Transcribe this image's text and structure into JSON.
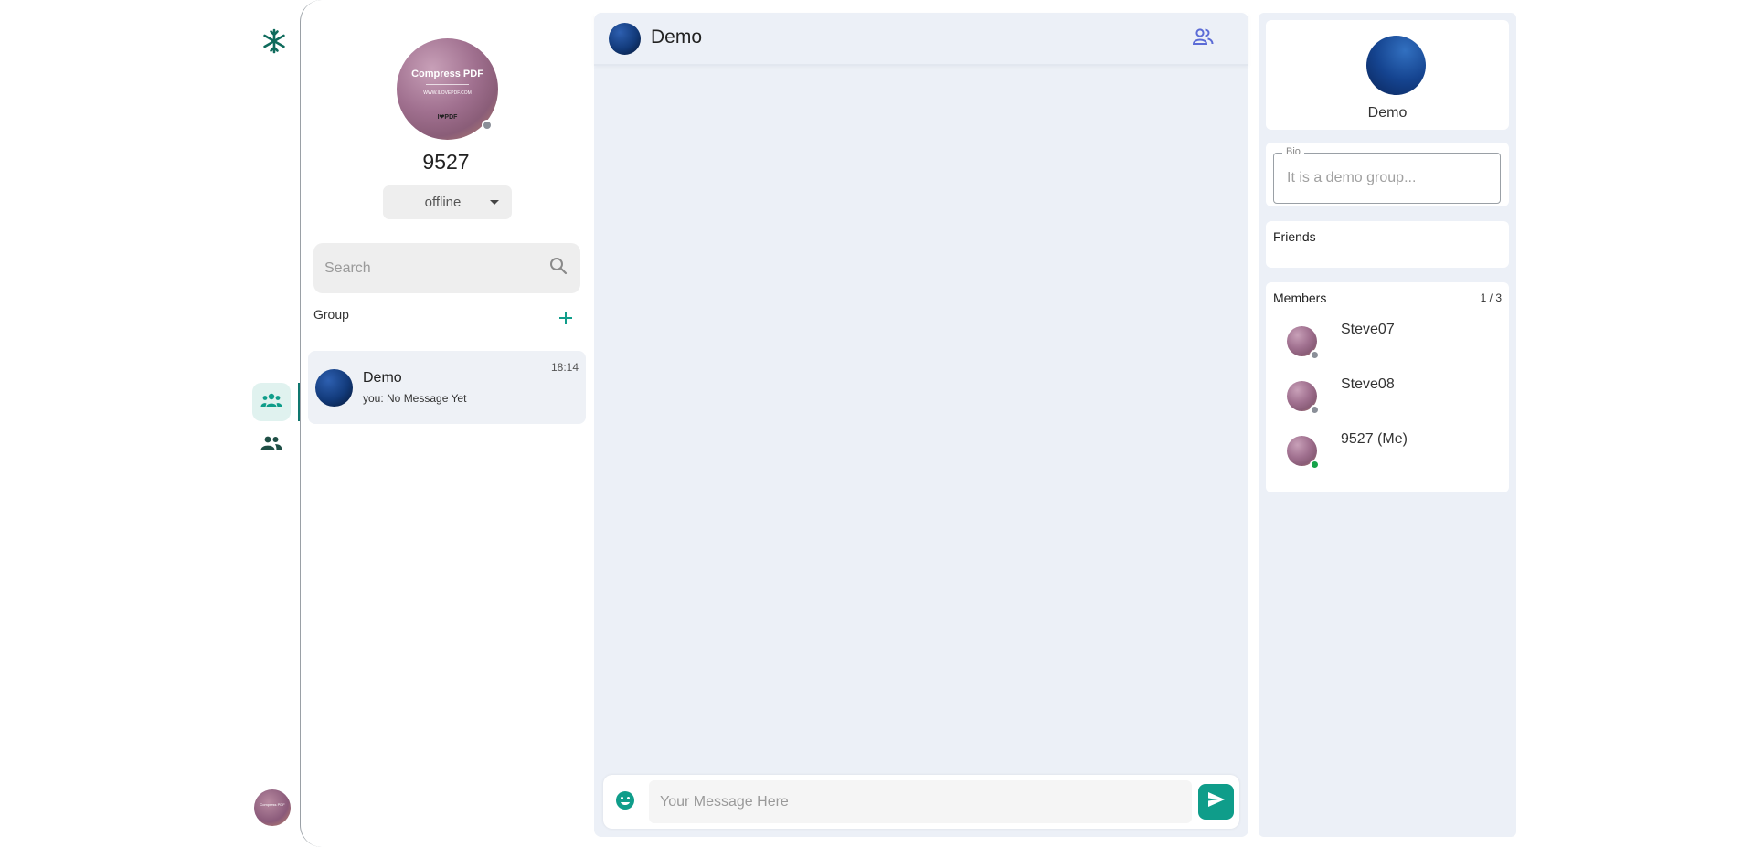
{
  "profile": {
    "name": "9527",
    "status": "offline",
    "avatar_text": {
      "line1": "Compress PDF",
      "line2": "WWW.ILOVEPDF.COM",
      "line3": "I❤PDF"
    }
  },
  "sidebar": {
    "search_placeholder": "Search",
    "section_label": "Group",
    "conversations": [
      {
        "name": "Demo",
        "preview": "you: No Message Yet",
        "time": "18:14"
      }
    ]
  },
  "chat": {
    "title": "Demo",
    "message_placeholder": "Your Message Here"
  },
  "info": {
    "name": "Demo",
    "bio_label": "Bio",
    "bio_placeholder": "It is a demo group...",
    "friends_label": "Friends",
    "members_label": "Members",
    "member_count": "1 / 3",
    "members": [
      {
        "name": "Steve07",
        "status": "offline"
      },
      {
        "name": "Steve08",
        "status": "offline"
      },
      {
        "name": "9527 (Me)",
        "status": "online"
      }
    ]
  },
  "colors": {
    "accent": "#0f9d8a",
    "accent_dark": "#0f766e",
    "panel_bg": "#ecf0f7",
    "members_icon": "#5b6bd6"
  },
  "icons": [
    "snowflake-icon",
    "group-icon",
    "people-icon",
    "search-icon",
    "plus-icon",
    "members-icon",
    "emoji-icon",
    "send-icon"
  ]
}
